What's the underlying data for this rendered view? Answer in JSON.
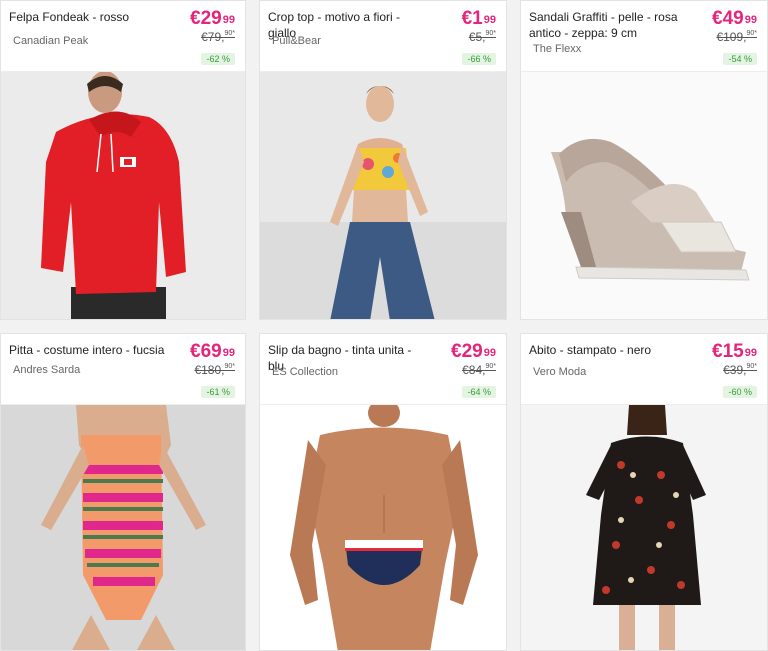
{
  "products": [
    {
      "title": "Felpa Fondeak - rosso",
      "brand": "Canadian Peak",
      "price": "€29",
      "price_cents": "99",
      "old_price": "€79,",
      "old_cents": "90*",
      "discount": "-62 %",
      "image": "red-hoodie-man"
    },
    {
      "title": "Crop top - motivo a fiori - giallo",
      "brand": "Pull&Bear",
      "price": "€1",
      "price_cents": "99",
      "old_price": "€5,",
      "old_cents": "90*",
      "discount": "-66 %",
      "image": "floral-crop-top-woman"
    },
    {
      "title": "Sandali Graffiti - pelle - rosa antico - zeppa: 9 cm",
      "brand": "The Flexx",
      "price": "€49",
      "price_cents": "99",
      "old_price": "€109,",
      "old_cents": "90*",
      "discount": "-54 %",
      "image": "wedge-sandal"
    },
    {
      "title": "Pitta - costume intero - fucsia",
      "brand": "Andres Sarda",
      "price": "€69",
      "price_cents": "99",
      "old_price": "€180,",
      "old_cents": "90*",
      "discount": "-61 %",
      "image": "striped-swimsuit-woman"
    },
    {
      "title": "Slip da bagno - tinta unita - blu",
      "brand": "ES Collection",
      "price": "€29",
      "price_cents": "99",
      "old_price": "€84,",
      "old_cents": "90*",
      "discount": "-64 %",
      "image": "navy-swim-brief-man"
    },
    {
      "title": "Abito - stampato - nero",
      "brand": "Vero Moda",
      "price": "€15",
      "price_cents": "99",
      "old_price": "€39,",
      "old_cents": "90*",
      "discount": "-60 %",
      "image": "printed-black-dress-woman"
    }
  ],
  "colors": {
    "price": "#e5247c",
    "discount_bg": "#e3f4e3",
    "discount_text": "#3a9a3a"
  }
}
